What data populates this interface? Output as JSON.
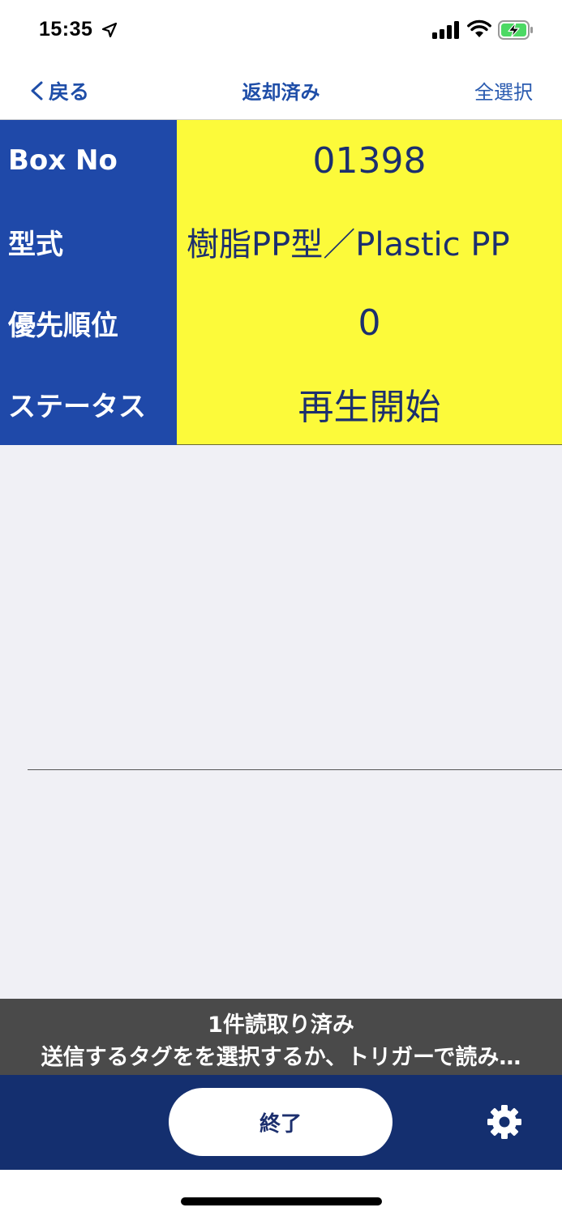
{
  "status_bar": {
    "time": "15:35",
    "icons": [
      "location-arrow-icon",
      "cellular-signal-icon",
      "wifi-icon",
      "battery-charging-icon"
    ],
    "battery_color": "#4cd964"
  },
  "nav": {
    "back_label": "戻る",
    "title": "返却済み",
    "select_all_label": "全選択"
  },
  "info": {
    "rows": [
      {
        "label": "Box No",
        "value": "01398"
      },
      {
        "label": "型式",
        "value": "樹脂PP型／Plastic PP"
      },
      {
        "label": "優先順位",
        "value": "0"
      },
      {
        "label": "ステータス",
        "value": "再生開始"
      }
    ]
  },
  "message": {
    "line1": "1件読取り済み",
    "line2": "送信するタグをを選択するか、トリガーで読み…"
  },
  "toolbar": {
    "end_label": "終了"
  },
  "colors": {
    "label_bg": "#1f49a9",
    "value_bg": "#fcfa3a",
    "toolbar_bg": "#142f6f",
    "message_bg": "#4a4a4a",
    "link": "#1f4ea8"
  }
}
